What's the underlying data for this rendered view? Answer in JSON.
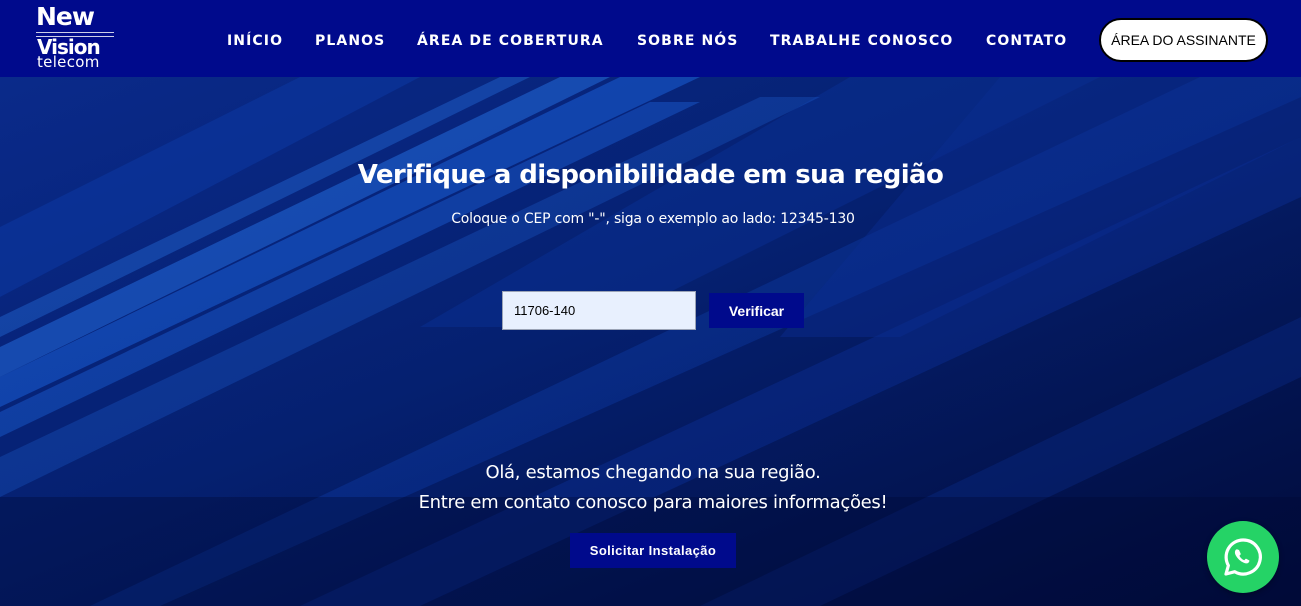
{
  "logo": {
    "line1": "New",
    "line2": "Vision",
    "line3": "telecom"
  },
  "nav": {
    "items": [
      {
        "label": "INÍCIO"
      },
      {
        "label": "PLANOS"
      },
      {
        "label": "ÁREA DE COBERTURA"
      },
      {
        "label": "SOBRE NÓS"
      },
      {
        "label": "TRABALHE CONOSCO"
      },
      {
        "label": "CONTATO"
      }
    ],
    "subscriber_button": "ÁREA DO ASSINANTE"
  },
  "hero": {
    "title": "Verifique a disponibilidade em sua região",
    "subtitle": "Coloque o CEP com \"-\", siga o exemplo ao lado: 12345-130",
    "cep_value": "11706-140",
    "verify_button": "Verificar",
    "message_line1": "Olá, estamos chegando na sua região.",
    "message_line2": "Entre em contato conosco para maiores informações!",
    "request_button": "Solicitar Instalação"
  },
  "floating": {
    "icon": "whatsapp-icon"
  },
  "colors": {
    "header_bg": "#000a8c",
    "button_bg": "#000a8c",
    "hero_bg": "#02124f",
    "whatsapp": "#25d366"
  }
}
